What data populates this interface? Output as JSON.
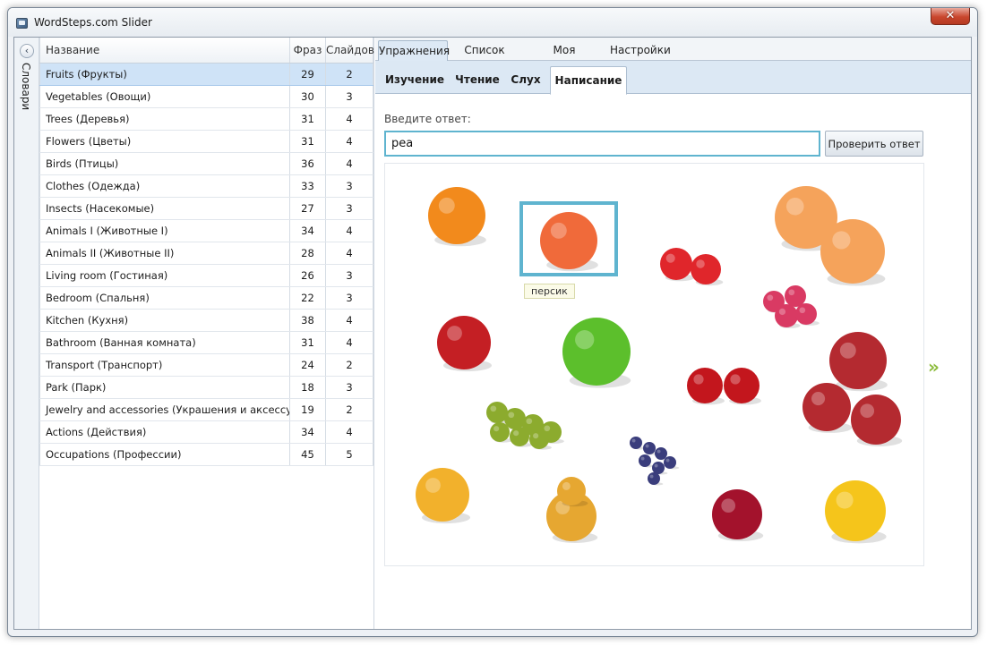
{
  "window": {
    "title": "WordSteps.com Slider"
  },
  "sidebar": {
    "vertical_tab_label": "Словари"
  },
  "dict_table": {
    "headers": [
      "Название",
      "Фраз",
      "Слайдов"
    ],
    "rows": [
      {
        "name": "Fruits (Фрукты)",
        "phrases": "29",
        "slides": "2"
      },
      {
        "name": "Vegetables (Овощи)",
        "phrases": "30",
        "slides": "3"
      },
      {
        "name": "Trees (Деревья)",
        "phrases": "31",
        "slides": "4"
      },
      {
        "name": "Flowers (Цветы)",
        "phrases": "31",
        "slides": "4"
      },
      {
        "name": "Birds (Птицы)",
        "phrases": "36",
        "slides": "4"
      },
      {
        "name": "Clothes (Одежда)",
        "phrases": "33",
        "slides": "3"
      },
      {
        "name": "Insects (Насекомые)",
        "phrases": "27",
        "slides": "3"
      },
      {
        "name": "Animals I (Животные I)",
        "phrases": "34",
        "slides": "4"
      },
      {
        "name": "Animals II (Животные II)",
        "phrases": "28",
        "slides": "4"
      },
      {
        "name": "Living room (Гостиная)",
        "phrases": "26",
        "slides": "3"
      },
      {
        "name": "Bedroom (Спальня)",
        "phrases": "22",
        "slides": "3"
      },
      {
        "name": "Kitchen (Кухня)",
        "phrases": "38",
        "slides": "4"
      },
      {
        "name": "Bathroom (Ванная комната)",
        "phrases": "31",
        "slides": "4"
      },
      {
        "name": "Transport (Транспорт)",
        "phrases": "24",
        "slides": "2"
      },
      {
        "name": "Park (Парк)",
        "phrases": "18",
        "slides": "3"
      },
      {
        "name": "Jewelry and accessories (Украшения и аксессуары)",
        "phrases": "19",
        "slides": "2"
      },
      {
        "name": "Actions (Действия)",
        "phrases": "34",
        "slides": "4"
      },
      {
        "name": "Occupations (Профессии)",
        "phrases": "45",
        "slides": "5"
      }
    ]
  },
  "main_tabs": [
    {
      "label": "Упражнения",
      "active": true
    },
    {
      "label": "Список слов",
      "active": false
    },
    {
      "label": "Моя статистика",
      "active": false
    },
    {
      "label": "Настройки",
      "active": false
    }
  ],
  "sub_tabs": [
    {
      "label": "Изучение",
      "active": false
    },
    {
      "label": "Чтение",
      "active": false
    },
    {
      "label": "Слух",
      "active": false
    },
    {
      "label": "Написание",
      "active": true
    }
  ],
  "exercise": {
    "answer_label": "Введите ответ:",
    "answer_value": "pea",
    "check_button_label": "Проверить ответ",
    "tooltip": "персик",
    "next_icon": "double-chevron-right-icon"
  },
  "fruits": [
    {
      "name": "orange",
      "color": "#f28a1c"
    },
    {
      "name": "peach",
      "color": "#f06a3a"
    },
    {
      "name": "strawberry",
      "color": "#e0262b"
    },
    {
      "name": "grapefruit",
      "color": "#f5a35b"
    },
    {
      "name": "raspberry",
      "color": "#d93a63"
    },
    {
      "name": "apple",
      "color": "#c41f24"
    },
    {
      "name": "lime",
      "color": "#5cbf2c"
    },
    {
      "name": "cherry",
      "color": "#c3161d"
    },
    {
      "name": "nectarine",
      "color": "#b42a30"
    },
    {
      "name": "grapes",
      "color": "#8cab2e"
    },
    {
      "name": "blueberry",
      "color": "#3a3d7c"
    },
    {
      "name": "apricot",
      "color": "#f2b12c"
    },
    {
      "name": "pear",
      "color": "#e6a731"
    },
    {
      "name": "plum",
      "color": "#a3122c"
    },
    {
      "name": "lemon",
      "color": "#f5c51b"
    }
  ]
}
